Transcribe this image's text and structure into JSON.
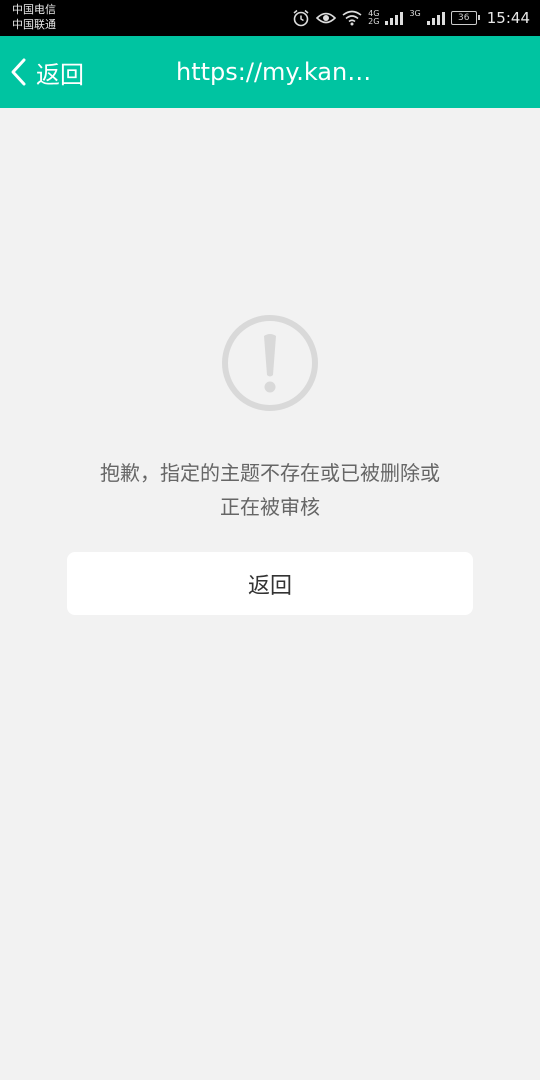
{
  "status_bar": {
    "carrier_1": "中国电信",
    "carrier_2": "中国联通",
    "net_1_top": "4G",
    "net_1_bottom": "2G",
    "net_2": "3G",
    "battery": "36",
    "time": "15:44",
    "icons": [
      "alarm-icon",
      "eye-icon",
      "wifi-icon",
      "signal-icon",
      "battery-icon"
    ]
  },
  "header": {
    "back_label": "返回",
    "title": "https://my.kan…",
    "background_color": "#00c4a1"
  },
  "main": {
    "icon": "warning-circle-icon",
    "message_line_1": "抱歉，指定的主题不存在或已被删除或",
    "message_line_2": "正在被审核",
    "button_label": "返回"
  }
}
